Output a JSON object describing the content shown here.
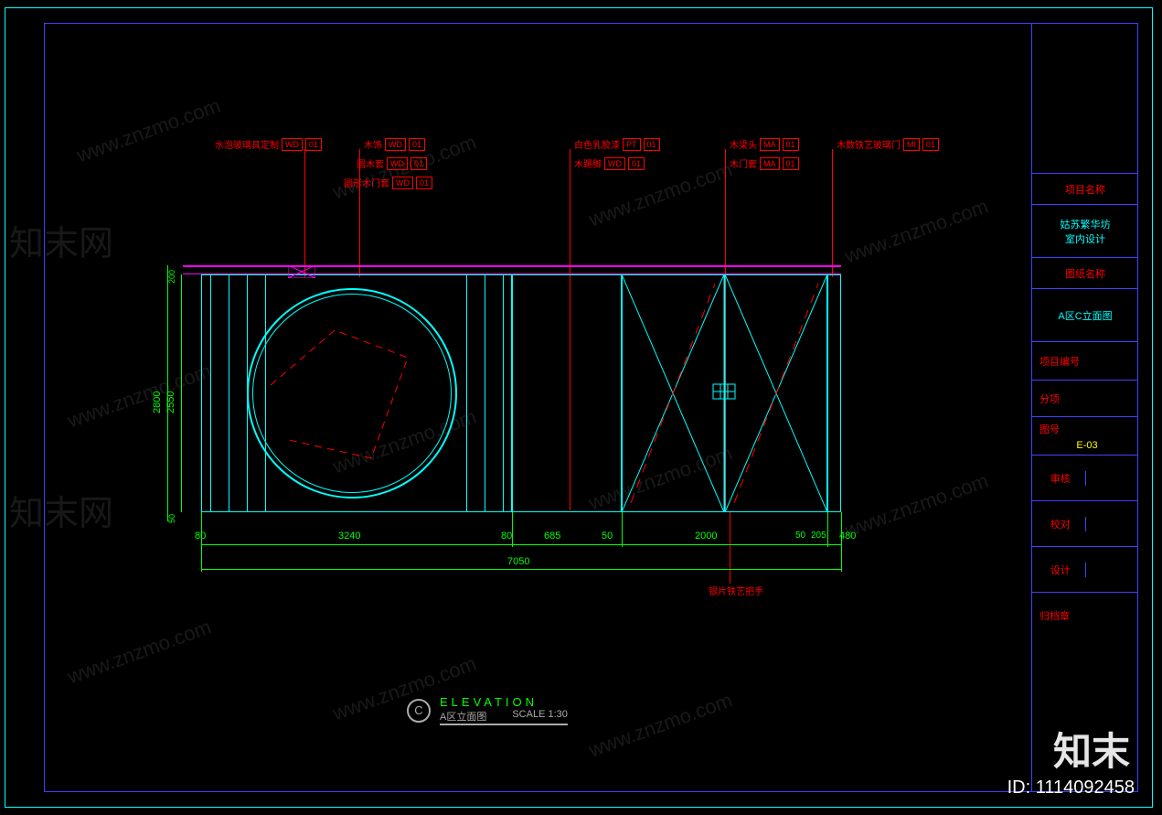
{
  "title_block": {
    "project_name_label": "项目名称",
    "project_name_line1": "姑苏繁华坊",
    "project_name_line2": "室内设计",
    "drawing_name_label": "图纸名称",
    "drawing_name_value": "A区C立面图",
    "project_no_label": "项目编号",
    "subproject_label": "分项",
    "sheet_no_label": "图号",
    "sheet_no_value": "E-03",
    "review_label": "审核",
    "check_label": "校对",
    "design_label": "设计",
    "archive_label": "归档章"
  },
  "callouts": {
    "c1": {
      "label": "水泡玻璃具定制",
      "code1": "WD",
      "code2": "01"
    },
    "c2": {
      "label": "木饰",
      "code1": "WD",
      "code2": "01"
    },
    "c3": {
      "label": "圆木套",
      "code1": "WD",
      "code2": "01"
    },
    "c4": {
      "label": "圆形木门套",
      "code1": "WD",
      "code2": "01"
    },
    "c5": {
      "label": "白色乳胶漆",
      "code1": "PT",
      "code2": "01"
    },
    "c6": {
      "label": "木踢脚",
      "code1": "WD",
      "code2": "01"
    },
    "c7": {
      "label": "木梁头",
      "code1": "MA",
      "code2": "01"
    },
    "c8": {
      "label": "木门套",
      "code1": "MA",
      "code2": "01"
    },
    "c9": {
      "label": "木数铁艺玻璃门",
      "code1": "MI",
      "code2": "01"
    },
    "c10": {
      "label": "银片铁艺把手"
    }
  },
  "dimensions": {
    "v_outer": "2800",
    "v_inner": "2550",
    "v_top1": "200",
    "v_bot": "50",
    "h1": "80",
    "h2": "3240",
    "h3": "80",
    "h4": "685",
    "h5": "50",
    "h6": "2000",
    "h7": "50",
    "h8": "205",
    "h9": "480",
    "h_total": "7050"
  },
  "title": {
    "marker": "C",
    "en": "ELEVATION",
    "cn": "A区立面图",
    "scale": "SCALE 1:30"
  },
  "watermark": "www.znzmo.com",
  "watermark_cn": "知末网",
  "brand": "知末",
  "id": "ID: 1114092458"
}
